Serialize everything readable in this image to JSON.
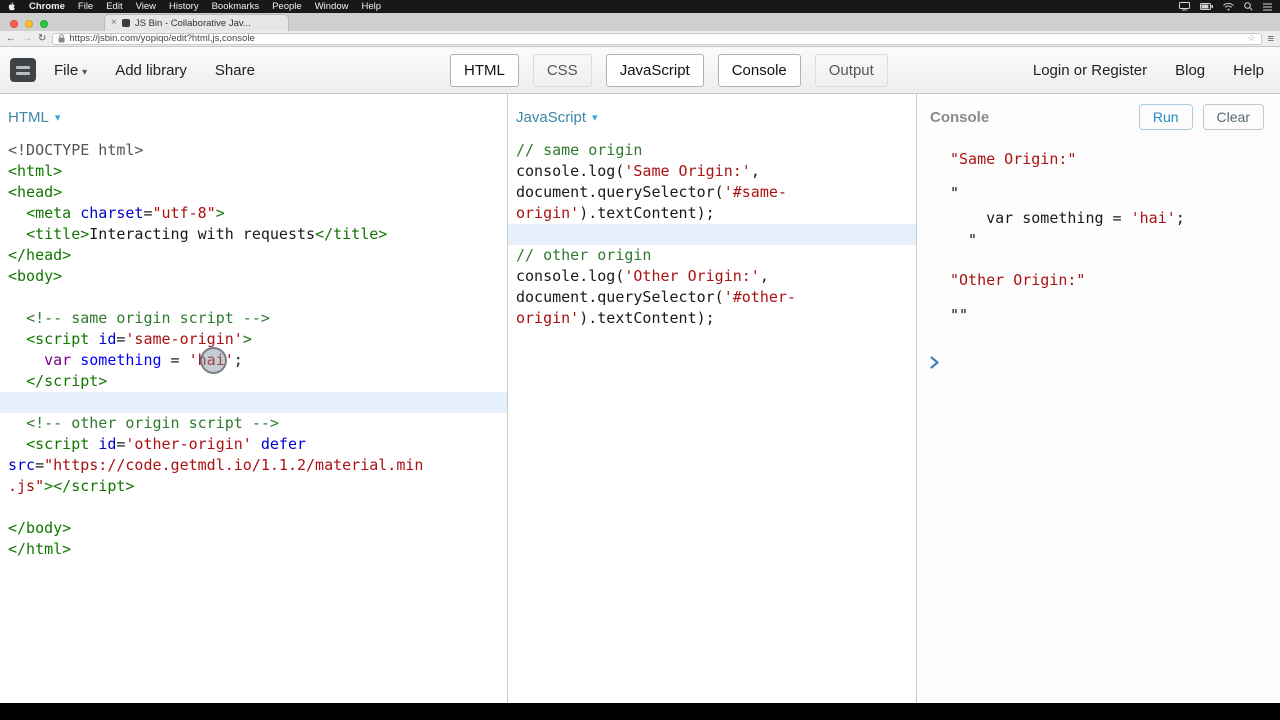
{
  "menubar": {
    "items": [
      "Chrome",
      "File",
      "Edit",
      "View",
      "History",
      "Bookmarks",
      "People",
      "Window",
      "Help"
    ]
  },
  "browser": {
    "tab_title": "JS Bin - Collaborative Jav...",
    "url": "https://jsbin.com/yopiqo/edit?html,js,console"
  },
  "toolbar": {
    "file_label": "File",
    "add_library_label": "Add library",
    "share_label": "Share",
    "panels": [
      {
        "label": "HTML",
        "active": true
      },
      {
        "label": "CSS",
        "active": false
      },
      {
        "label": "JavaScript",
        "active": true
      },
      {
        "label": "Console",
        "active": true
      },
      {
        "label": "Output",
        "active": false
      }
    ],
    "login_label": "Login or Register",
    "blog_label": "Blog",
    "help_label": "Help"
  },
  "icons": {
    "chevron_down": "▾",
    "back": "←",
    "forward": "→",
    "reload": "↻",
    "star": "☆",
    "burger": "≡",
    "tab_close": "×"
  },
  "html_panel": {
    "title": "HTML",
    "lines": [
      {
        "tk": [
          [
            "m",
            "<!DOCTYPE html>"
          ]
        ]
      },
      {
        "tk": [
          [
            "t",
            "<html>"
          ]
        ]
      },
      {
        "tk": [
          [
            "t",
            "<head>"
          ]
        ]
      },
      {
        "tk": [
          [
            "p",
            "  "
          ],
          [
            "t",
            "<meta "
          ],
          [
            "a",
            "charset"
          ],
          [
            "p",
            "="
          ],
          [
            "s",
            "\"utf-8\""
          ],
          [
            "t",
            ">"
          ]
        ]
      },
      {
        "tk": [
          [
            "p",
            "  "
          ],
          [
            "t",
            "<title>"
          ],
          [
            "p",
            "Interacting with requests"
          ],
          [
            "t",
            "</title>"
          ]
        ]
      },
      {
        "tk": [
          [
            "t",
            "</head>"
          ]
        ]
      },
      {
        "tk": [
          [
            "t",
            "<body>"
          ]
        ]
      },
      {
        "tk": []
      },
      {
        "tk": [
          [
            "p",
            "  "
          ],
          [
            "c",
            "<!-- same origin script -->"
          ]
        ]
      },
      {
        "tk": [
          [
            "p",
            "  "
          ],
          [
            "t",
            "<script "
          ],
          [
            "a",
            "id"
          ],
          [
            "p",
            "="
          ],
          [
            "s",
            "'same-origin'"
          ],
          [
            "t",
            ">"
          ]
        ]
      },
      {
        "tk": [
          [
            "p",
            "    "
          ],
          [
            "k",
            "var"
          ],
          [
            "p",
            " "
          ],
          [
            "d",
            "something"
          ],
          [
            "p",
            " = "
          ],
          [
            "s",
            "'hai'"
          ],
          [
            "p",
            ";"
          ]
        ]
      },
      {
        "tk": [
          [
            "p",
            "  "
          ],
          [
            "t",
            "</script>"
          ]
        ]
      },
      {
        "hl": true,
        "tk": []
      },
      {
        "tk": [
          [
            "p",
            "  "
          ],
          [
            "c",
            "<!-- other origin script -->"
          ]
        ]
      },
      {
        "tk": [
          [
            "p",
            "  "
          ],
          [
            "t",
            "<script "
          ],
          [
            "a",
            "id"
          ],
          [
            "p",
            "="
          ],
          [
            "s",
            "'other-origin'"
          ],
          [
            "p",
            " "
          ],
          [
            "a",
            "defer"
          ]
        ]
      },
      {
        "tk": [
          [
            "a",
            "src"
          ],
          [
            "p",
            "="
          ],
          [
            "s",
            "\"https://code.getmdl.io/1.1.2/material.min"
          ]
        ]
      },
      {
        "tk": [
          [
            "s",
            ".js\""
          ],
          [
            "t",
            "></script>"
          ]
        ]
      },
      {
        "tk": []
      },
      {
        "tk": [
          [
            "t",
            "</body>"
          ]
        ]
      },
      {
        "tk": [
          [
            "t",
            "</html>"
          ]
        ]
      }
    ]
  },
  "js_panel": {
    "title": "JavaScript",
    "lines": [
      {
        "tk": [
          [
            "c",
            "// same origin"
          ]
        ]
      },
      {
        "tk": [
          [
            "p",
            "console.log("
          ],
          [
            "s",
            "'Same Origin:'"
          ],
          [
            "p",
            ","
          ]
        ]
      },
      {
        "tk": [
          [
            "p",
            "document.querySelector("
          ],
          [
            "s",
            "'#same-"
          ]
        ]
      },
      {
        "tk": [
          [
            "s",
            "origin'"
          ],
          [
            "p",
            ").textContent);"
          ]
        ]
      },
      {
        "hl": true,
        "tk": []
      },
      {
        "tk": [
          [
            "c",
            "// other origin"
          ]
        ]
      },
      {
        "tk": [
          [
            "p",
            "console.log("
          ],
          [
            "s",
            "'Other Origin:'"
          ],
          [
            "p",
            ","
          ]
        ]
      },
      {
        "tk": [
          [
            "p",
            "document.querySelector("
          ],
          [
            "s",
            "'#other-"
          ]
        ]
      },
      {
        "tk": [
          [
            "s",
            "origin'"
          ],
          [
            "p",
            ").textContent);"
          ]
        ]
      }
    ]
  },
  "console_panel": {
    "title": "Console",
    "run_label": "Run",
    "clear_label": "Clear",
    "prompt_icon": "chevron-right",
    "lines": [
      {
        "tk": [
          [
            "s",
            "\"Same Origin:\""
          ]
        ]
      },
      {
        "tk": [
          [
            "p",
            "\""
          ]
        ]
      },
      {
        "tk": [
          [
            "p",
            "    var something = "
          ],
          [
            "s",
            "'hai'"
          ],
          [
            "p",
            ";"
          ]
        ]
      },
      {
        "tk": [
          [
            "p",
            "  \""
          ]
        ]
      },
      {
        "tk": [
          [
            "s",
            "\"Other Origin:\""
          ]
        ]
      },
      {
        "tk": [
          [
            "p",
            "\"\""
          ]
        ]
      }
    ]
  },
  "colors": {
    "tag": "#117700",
    "attribute": "#0000cc",
    "string": "#aa1111",
    "comment": "#2f7a2f",
    "keyword": "#770088",
    "def": "#0000ff",
    "meta": "#555555",
    "plain": "#1a1a1a",
    "highlight_line": "#e6f0fa",
    "header_label": "#3c87a8",
    "caret_blue": "#31a9d8",
    "run_text": "#2789c7",
    "prompt_blue": "#3b82c4"
  }
}
